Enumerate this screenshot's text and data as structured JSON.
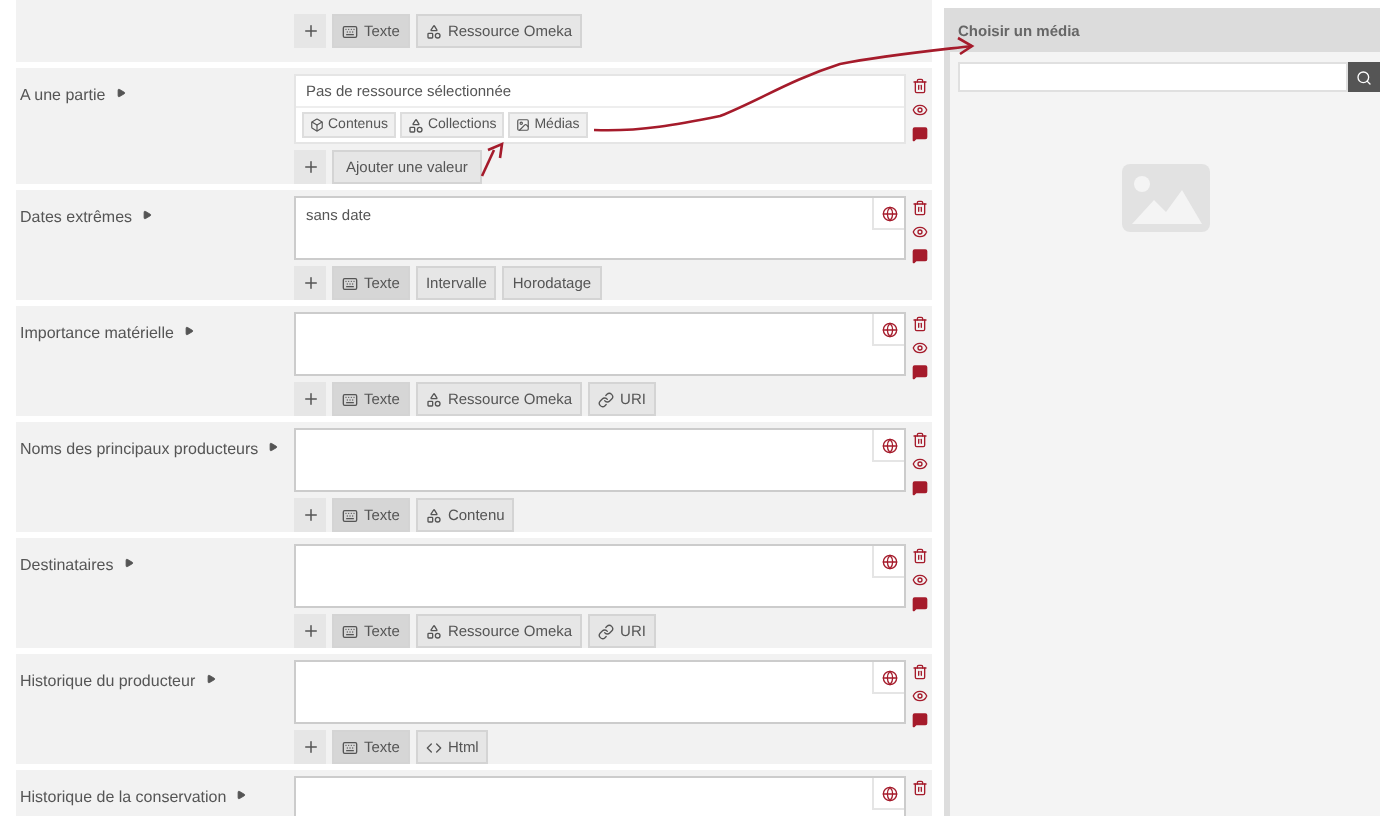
{
  "properties": [
    {
      "kind": "tail",
      "types": [
        {
          "label": "Texte",
          "kind": "text",
          "selected": true
        },
        {
          "label": "Ressource Omeka",
          "kind": "resource",
          "selected": false
        }
      ]
    },
    {
      "kind": "resource",
      "label": "A une partie",
      "value": "Pas de ressource sélectionnée",
      "choices": [
        {
          "label": "Contenus",
          "kind": "item"
        },
        {
          "label": "Collections",
          "kind": "resource"
        },
        {
          "label": "Médias",
          "kind": "media"
        }
      ],
      "add": "Ajouter une valeur"
    },
    {
      "kind": "text",
      "label": "Dates extrêmes",
      "value": "sans date",
      "types": [
        {
          "label": "Texte",
          "kind": "text",
          "selected": true
        },
        {
          "label": "Intervalle",
          "kind": "plain",
          "selected": false
        },
        {
          "label": "Horodatage",
          "kind": "plain",
          "selected": false
        }
      ]
    },
    {
      "kind": "text",
      "label": "Importance matérielle",
      "types": [
        {
          "label": "Texte",
          "kind": "text",
          "selected": true
        },
        {
          "label": "Ressource Omeka",
          "kind": "resource",
          "selected": false
        },
        {
          "label": "URI",
          "kind": "uri",
          "selected": false
        }
      ]
    },
    {
      "kind": "text",
      "label": "Noms des principaux producteurs",
      "types": [
        {
          "label": "Texte",
          "kind": "text",
          "selected": true
        },
        {
          "label": "Contenu",
          "kind": "resource",
          "selected": false
        }
      ]
    },
    {
      "kind": "text",
      "label": "Destinataires",
      "types": [
        {
          "label": "Texte",
          "kind": "text",
          "selected": true
        },
        {
          "label": "Ressource Omeka",
          "kind": "resource",
          "selected": false
        },
        {
          "label": "URI",
          "kind": "uri",
          "selected": false
        }
      ]
    },
    {
      "kind": "text",
      "label": "Historique du producteur",
      "types": [
        {
          "label": "Texte",
          "kind": "text",
          "selected": true
        },
        {
          "label": "Html",
          "kind": "html",
          "selected": false
        }
      ]
    },
    {
      "kind": "text",
      "label": "Historique de la conservation"
    }
  ],
  "sidebar": {
    "title": "Choisir un média"
  }
}
